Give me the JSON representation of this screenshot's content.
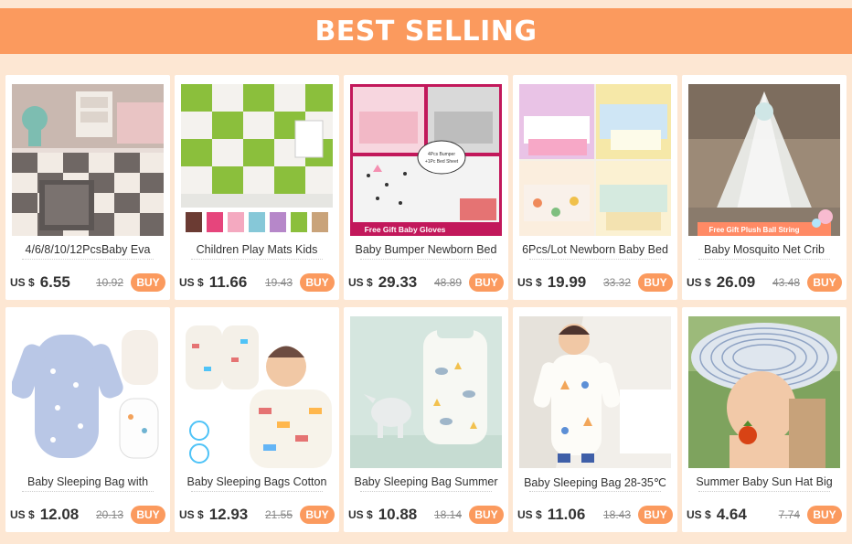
{
  "banner": {
    "title": "BEST SELLING"
  },
  "colors": {
    "accent": "#fb9a5e",
    "background": "#fde7d3"
  },
  "products": [
    {
      "title": "4/6/8/10/12PcsBaby Eva",
      "currency": "US $",
      "price": "6.55",
      "old_price": "10.92",
      "buy_label": "BUY",
      "image": "foam-floor-mats-image"
    },
    {
      "title": "Children Play Mats Kids",
      "currency": "US $",
      "price": "11.66",
      "old_price": "19.43",
      "buy_label": "BUY",
      "image": "green-play-mat-image"
    },
    {
      "title": "Baby Bumper Newborn Bed",
      "currency": "US $",
      "price": "29.33",
      "old_price": "48.89",
      "buy_label": "BUY",
      "image": "crib-bumper-image",
      "badge": "Free Gift Baby Gloves",
      "bubble": "4Pcs Bumper +1Pc Bed Sheet"
    },
    {
      "title": "6Pcs/Lot Newborn Baby Bed",
      "currency": "US $",
      "price": "19.99",
      "old_price": "33.32",
      "buy_label": "BUY",
      "image": "bed-bumper-set-image"
    },
    {
      "title": "Baby Mosquito Net Crib",
      "currency": "US $",
      "price": "26.09",
      "old_price": "43.48",
      "buy_label": "BUY",
      "image": "mosquito-net-image",
      "badge": "Free Gift Plush Ball String"
    },
    {
      "title": "Baby Sleeping Bag with",
      "currency": "US $",
      "price": "12.08",
      "old_price": "20.13",
      "buy_label": "BUY",
      "image": "sleeping-bag-blue-image"
    },
    {
      "title": "Baby Sleeping Bags Cotton",
      "currency": "US $",
      "price": "12.93",
      "old_price": "21.55",
      "buy_label": "BUY",
      "image": "sleeping-bag-cars-image"
    },
    {
      "title": "Baby Sleeping Bag Summer",
      "currency": "US $",
      "price": "10.88",
      "old_price": "18.14",
      "buy_label": "BUY",
      "image": "sleeping-bag-rhino-image"
    },
    {
      "title": "Baby Sleeping Bag 28-35℃",
      "currency": "US $",
      "price": "11.06",
      "old_price": "18.43",
      "buy_label": "BUY",
      "image": "sleeping-bag-toddler-image"
    },
    {
      "title": "Summer Baby Sun Hat Big",
      "currency": "US $",
      "price": "4.64",
      "old_price": "7.74",
      "buy_label": "BUY",
      "image": "sun-hat-image"
    }
  ]
}
